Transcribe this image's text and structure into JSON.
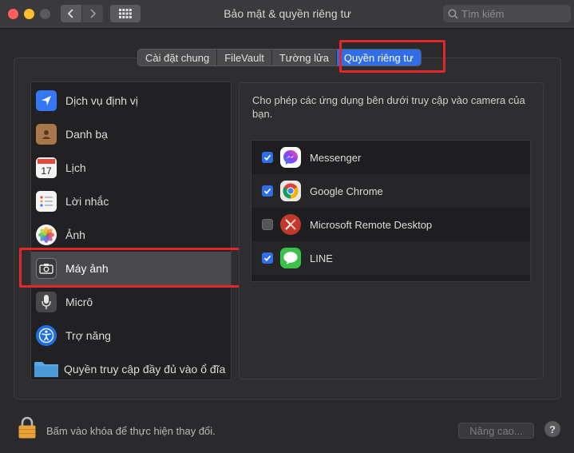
{
  "window": {
    "title": "Bảo mật & quyền riêng tư",
    "search_placeholder": "Tìm kiếm"
  },
  "tabs": [
    {
      "label": "Cài đặt chung",
      "active": false
    },
    {
      "label": "FileVault",
      "active": false
    },
    {
      "label": "Tường lửa",
      "active": false
    },
    {
      "label": "Quyền riêng tư",
      "active": true
    }
  ],
  "sidebar": {
    "items": [
      {
        "label": "Dịch vụ định vị",
        "icon": "location-icon",
        "selected": false
      },
      {
        "label": "Danh bạ",
        "icon": "contacts-icon",
        "selected": false
      },
      {
        "label": "Lịch",
        "icon": "calendar-icon",
        "selected": false
      },
      {
        "label": "Lời nhắc",
        "icon": "reminders-icon",
        "selected": false
      },
      {
        "label": "Ảnh",
        "icon": "photos-icon",
        "selected": false
      },
      {
        "label": "Máy ảnh",
        "icon": "camera-icon",
        "selected": true
      },
      {
        "label": "Micrô",
        "icon": "microphone-icon",
        "selected": false
      },
      {
        "label": "Trợ năng",
        "icon": "accessibility-icon",
        "selected": false
      },
      {
        "label": "Quyền truy cập đầy đủ vào ổ đĩa",
        "icon": "folder-icon",
        "selected": false
      }
    ]
  },
  "content": {
    "description": "Cho phép các ứng dụng bên dưới truy cập vào camera của bạn.",
    "apps": [
      {
        "name": "Messenger",
        "checked": true,
        "icon": "messenger-icon"
      },
      {
        "name": "Google Chrome",
        "checked": true,
        "icon": "chrome-icon"
      },
      {
        "name": "Microsoft Remote Desktop",
        "checked": false,
        "icon": "remote-desktop-icon"
      },
      {
        "name": "LINE",
        "checked": true,
        "icon": "line-icon"
      }
    ]
  },
  "footer": {
    "lock_text": "Bấm vào khóa để thực hiện thay đổi.",
    "advanced_label": "Nâng cao...",
    "help_label": "?"
  },
  "colors": {
    "accent": "#2f6ee6",
    "highlight_box": "#e3262a",
    "window_bg": "#2a2a2c"
  }
}
